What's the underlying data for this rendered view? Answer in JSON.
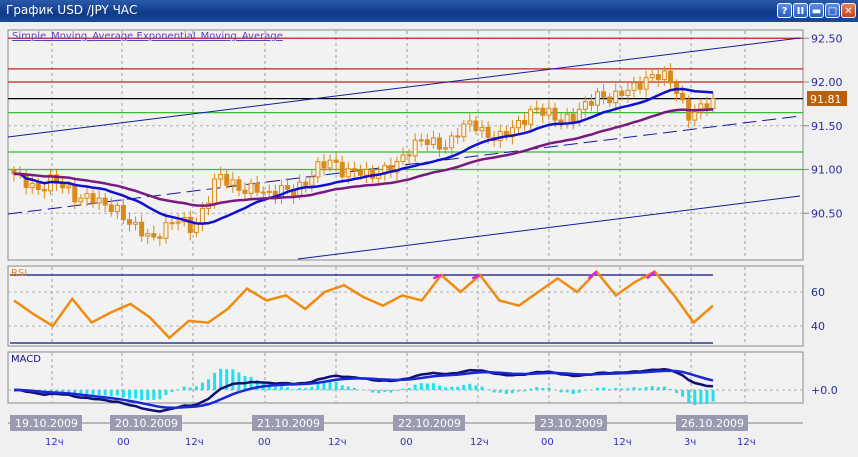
{
  "window": {
    "title": "График USD /JPY  ЧАС",
    "buttons": [
      {
        "name": "help",
        "glyph": "?"
      },
      {
        "name": "pause",
        "glyph": "II"
      },
      {
        "name": "minimize",
        "glyph": "▬"
      },
      {
        "name": "maximize",
        "glyph": "□"
      },
      {
        "name": "close",
        "glyph": "✕"
      }
    ]
  },
  "colors": {
    "candle": "#d98a1c",
    "sma": "#1010d0",
    "ema": "#7a1a80",
    "rsi": "#f08a10",
    "rsi_overbought": "#e020e0",
    "macd_main": "#101070",
    "macd_signal": "#1828d8",
    "macd_hist": "#20e0f0",
    "current_price_bg": "#b8600c",
    "channel": "#1818a0"
  },
  "chart_data": {
    "type": "candlestick",
    "indicator_label": "Simple_Moving_Average Exponential_Moving_Average",
    "symbol": "USD/JPY",
    "timeframe": "H1",
    "y_ticks": [
      "92.50",
      "92.00",
      "91.50",
      "91.00",
      "90.50"
    ],
    "y_tick_values": [
      92.5,
      92.0,
      91.5,
      91.0,
      90.5
    ],
    "ylim": [
      90.2,
      92.55
    ],
    "current_price": "91.81",
    "current_price_value": 91.81,
    "price_keypoints": [
      90.95,
      90.85,
      90.75,
      90.9,
      90.8,
      90.65,
      90.7,
      90.6,
      90.55,
      90.4,
      90.3,
      90.2,
      90.35,
      90.45,
      90.3,
      90.55,
      90.95,
      90.85,
      90.75,
      90.8,
      90.7,
      90.78,
      90.75,
      90.85,
      91.05,
      91.1,
      90.95,
      91.0,
      90.92,
      90.98,
      91.05,
      91.2,
      91.35,
      91.3,
      91.25,
      91.45,
      91.55,
      91.4,
      91.35,
      91.45,
      91.55,
      91.7,
      91.65,
      91.55,
      91.6,
      91.75,
      91.85,
      91.8,
      91.9,
      91.95,
      92.05,
      92.1,
      91.95,
      91.6,
      91.7,
      91.81
    ],
    "horizontal_levels": [
      {
        "value": 92.5,
        "color": "#d02020"
      },
      {
        "value": 92.15,
        "color": "#d02020"
      },
      {
        "value": 92.0,
        "color": "#d02020"
      },
      {
        "value": 91.81,
        "color": "#000000"
      },
      {
        "value": 91.65,
        "color": "#30c030"
      },
      {
        "value": 91.2,
        "color": "#30c030"
      },
      {
        "value": 91.0,
        "color": "#30c030"
      }
    ],
    "rsi": {
      "label": "RSI",
      "y_ticks": [
        "60",
        "40"
      ],
      "y_tick_values": [
        60,
        40
      ],
      "levels": [
        70,
        30
      ],
      "keypoints": [
        55,
        47,
        40,
        56,
        42,
        48,
        53,
        45,
        33,
        43,
        42,
        50,
        62,
        55,
        58,
        50,
        60,
        64,
        57,
        52,
        58,
        55,
        70,
        60,
        70,
        55,
        52,
        60,
        68,
        60,
        72,
        58,
        66,
        72,
        58,
        42,
        52
      ]
    },
    "macd": {
      "label": "MACD",
      "y_ticks": [
        "+0.0"
      ],
      "y_tick_values": [
        0
      ]
    },
    "x_dates": [
      "19.10.2009",
      "20.10.2009",
      "21.10.2009",
      "22.10.2009",
      "23.10.2009",
      "26.10.2009"
    ],
    "x_hours": [
      "12ч",
      "00",
      "12ч",
      "00",
      "12ч",
      "00",
      "12ч",
      "00",
      "12ч",
      "3ч",
      "12ч"
    ]
  }
}
